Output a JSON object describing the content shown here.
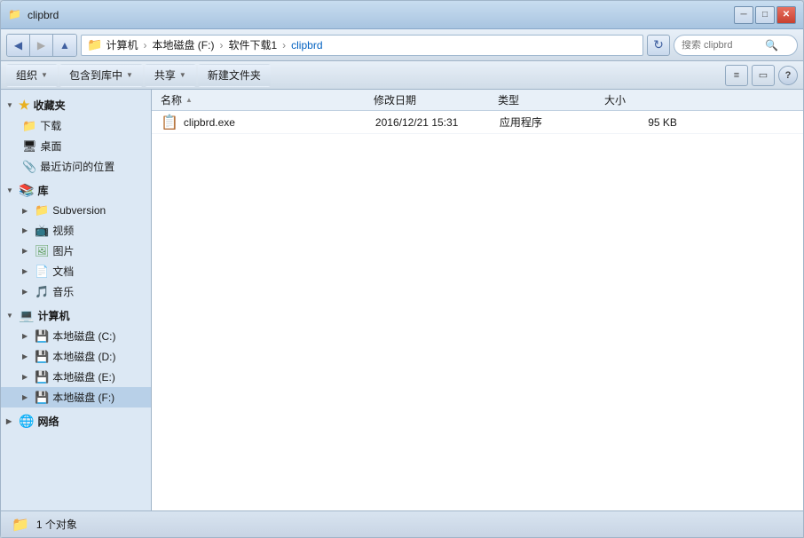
{
  "window": {
    "title": "clipbrd"
  },
  "titlebar": {
    "minimize": "─",
    "maximize": "□",
    "close": "✕"
  },
  "addressbar": {
    "path_parts": [
      "计算机",
      "本地磁盘 (F:)",
      "软件下载1",
      "clipbrd"
    ],
    "search_placeholder": "搜索 clipbrd",
    "search_icon": "🔍"
  },
  "toolbar": {
    "organize": "组织",
    "include_in_library": "包含到库中",
    "share": "共享",
    "new_folder": "新建文件夹",
    "view_icon": "≡",
    "layout_icon": "▭",
    "help": "?"
  },
  "sidebar": {
    "favorites": {
      "label": "收藏夹",
      "items": [
        {
          "icon": "⬇",
          "label": "下载"
        },
        {
          "icon": "🖥",
          "label": "桌面"
        },
        {
          "icon": "📎",
          "label": "最近访问的位置"
        }
      ]
    },
    "library": {
      "label": "库",
      "items": [
        {
          "icon": "📁",
          "label": "Subversion"
        },
        {
          "icon": "🎬",
          "label": "视频"
        },
        {
          "icon": "🖼",
          "label": "图片"
        },
        {
          "icon": "📄",
          "label": "文档"
        },
        {
          "icon": "🎵",
          "label": "音乐"
        }
      ]
    },
    "computer": {
      "label": "计算机",
      "items": [
        {
          "icon": "💾",
          "label": "本地磁盘 (C:)"
        },
        {
          "icon": "💾",
          "label": "本地磁盘 (D:)"
        },
        {
          "icon": "💾",
          "label": "本地磁盘 (E:)"
        },
        {
          "icon": "💾",
          "label": "本地磁盘 (F:)",
          "selected": true
        }
      ]
    },
    "network": {
      "label": "网络"
    }
  },
  "filelist": {
    "columns": [
      {
        "label": "名称",
        "sort": "▲"
      },
      {
        "label": "修改日期"
      },
      {
        "label": "类型"
      },
      {
        "label": "大小"
      }
    ],
    "files": [
      {
        "icon": "📋",
        "name": "clipbrd.exe",
        "date": "2016/12/21 15:31",
        "type": "应用程序",
        "size": "95 KB"
      }
    ]
  },
  "statusbar": {
    "count": "1 个对象"
  }
}
